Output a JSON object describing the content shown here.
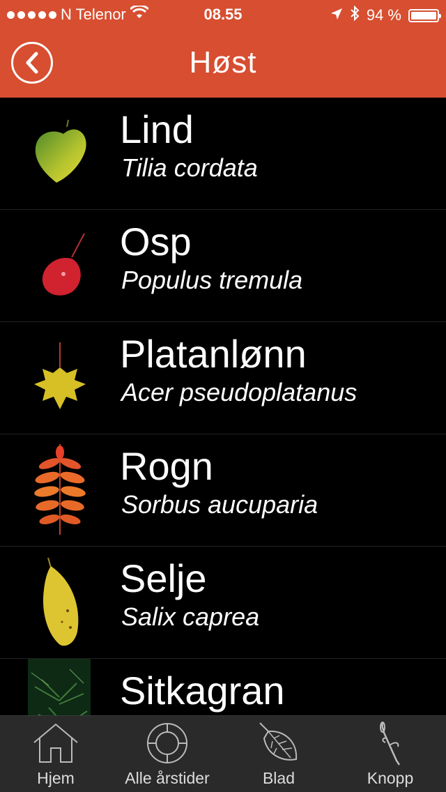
{
  "status": {
    "carrier": "N Telenor",
    "time": "08.55",
    "battery_text": "94 %",
    "battery_level": 0.94
  },
  "nav": {
    "title": "Høst"
  },
  "list": [
    {
      "name": "Lind",
      "latin": "Tilia cordata",
      "icon": "linden-leaf-icon"
    },
    {
      "name": "Osp",
      "latin": "Populus tremula",
      "icon": "aspen-leaf-icon"
    },
    {
      "name": "Platanlønn",
      "latin": "Acer pseudoplatanus",
      "icon": "maple-leaf-icon"
    },
    {
      "name": "Rogn",
      "latin": "Sorbus aucuparia",
      "icon": "rowan-leaf-icon"
    },
    {
      "name": "Selje",
      "latin": "Salix caprea",
      "icon": "willow-leaf-icon"
    },
    {
      "name": "Sitkagran",
      "latin": "",
      "icon": "spruce-photo-icon"
    }
  ],
  "tabs": [
    {
      "label": "Hjem",
      "icon": "home-icon"
    },
    {
      "label": "Alle årstider",
      "icon": "seasons-wheel-icon"
    },
    {
      "label": "Blad",
      "icon": "leaf-outline-icon"
    },
    {
      "label": "Knopp",
      "icon": "bud-twig-icon"
    }
  ],
  "colors": {
    "accent": "#d74e30",
    "background": "#000000",
    "tabbar": "#2a2a2a"
  }
}
